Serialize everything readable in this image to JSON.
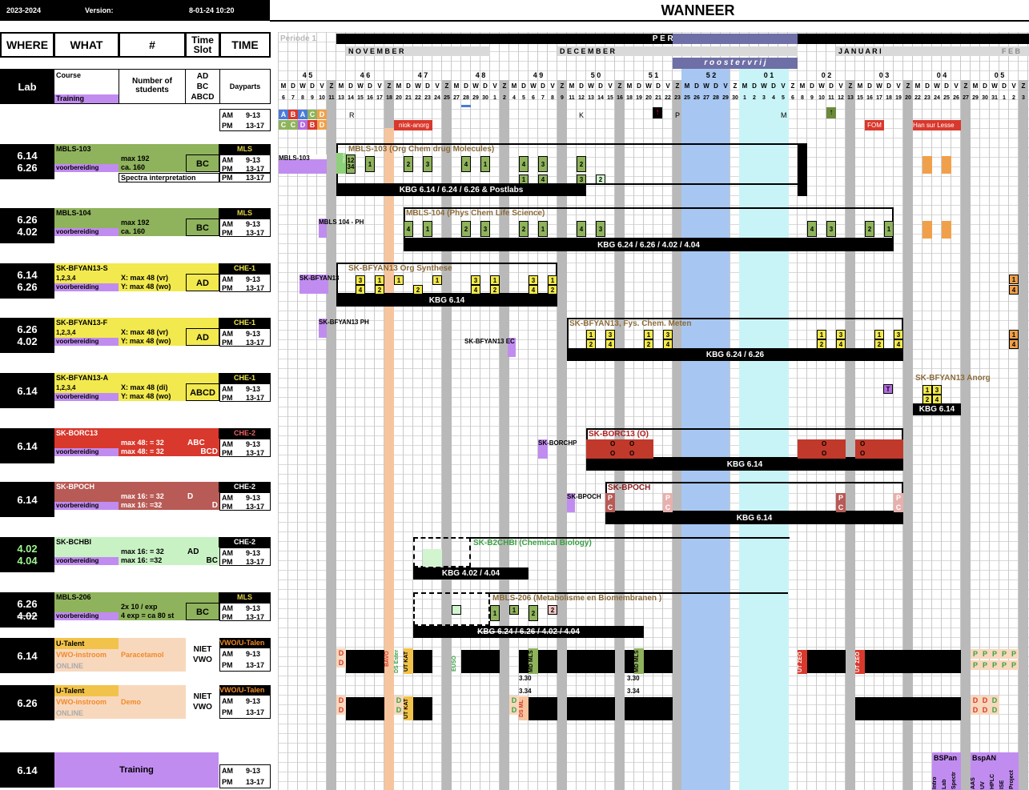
{
  "header": {
    "year": "2023-2024",
    "version_label": "Version:",
    "version_date": "8-01-24 10:20",
    "title": "WANNEER"
  },
  "columns": {
    "where": "WHERE",
    "what": "WHAT",
    "num": "#",
    "timeslot": "Time Slot",
    "time": "TIME"
  },
  "legend": {
    "lab": "Lab",
    "course": "Course",
    "training": "Training",
    "num_students": "Number of students",
    "slots": "AD\nBC\nABCD",
    "dayparts": "Dayparts"
  },
  "am": "AM",
  "pm": "PM",
  "am_time": "9-13",
  "pm_time": "13-17",
  "abcd_am": [
    "A",
    "B",
    "A",
    "C",
    "D"
  ],
  "abcd_pm": [
    "C",
    "C",
    "D",
    "B",
    "D"
  ],
  "periods": {
    "p1": "Periode 1",
    "p2": "P E R I O D E   2",
    "roostervrij": "r o o s t e r v r i j"
  },
  "months": {
    "nov": "N O V E M B E R",
    "dec": "D E C E M B E R",
    "jan": "J A N U A R I",
    "feb": "F E B"
  },
  "weeks": [
    "4 5",
    "4 6",
    "4 7",
    "4 8",
    "4 9",
    "5 0",
    "5 1",
    "5 2",
    "0 1",
    "0 2",
    "0 3",
    "0 4",
    "0 5"
  ],
  "daynames": "M D W D V Z",
  "dates": [
    "6",
    "7",
    "8",
    "9",
    "10",
    "11",
    "13",
    "14",
    "15",
    "16",
    "17",
    "18",
    "20",
    "21",
    "22",
    "23",
    "24",
    "25",
    "27",
    "28",
    "29",
    "30",
    "1",
    "2",
    "4",
    "5",
    "6",
    "7",
    "8",
    "9",
    "11",
    "12",
    "13",
    "14",
    "15",
    "16",
    "18",
    "19",
    "20",
    "21",
    "22",
    "23",
    "25",
    "26",
    "27",
    "28",
    "29",
    "30",
    "1",
    "2",
    "3",
    "4",
    "5",
    "6",
    "8",
    "9",
    "10",
    "11",
    "12",
    "13",
    "15",
    "16",
    "17",
    "18",
    "19",
    "20",
    "22",
    "23",
    "24",
    "25",
    "26",
    "27",
    "29",
    "30",
    "31",
    "1",
    "2",
    "3"
  ],
  "markers": {
    "R": "R",
    "K": "K",
    "P": "P",
    "M": "M",
    "niokanorg": "niok-anorg",
    "fom": "FOM",
    "han": "Han sur Lesse"
  },
  "rows": [
    {
      "lab1": "6.14",
      "lab2": "6.26",
      "course": "MBLS-103",
      "dept": "MLS",
      "train": "voorbereiding",
      "n1": "max 192",
      "n2": "ca. 160",
      "slot": "BC",
      "extra": "Spectra interpretation",
      "tag": "MBLS-103",
      "gtitle": "MBLS-103 (Org Chem drug Molecules)",
      "bar": "KBG 6.14 / 6.24 / 6.26 & Postlabs",
      "color": "#8fb35c"
    },
    {
      "lab1": "6.26",
      "lab2": "4.02",
      "course": "MBLS-104",
      "dept": "MLS",
      "train": "voorbereiding",
      "n1": "max 192",
      "n2": "ca. 160",
      "slot": "BC",
      "tag": "MBLS 104 - PH",
      "gtitle": "MBLS-104 (Phys Chem Life Science)",
      "bar": "KBG 6.24 / 6.26 /  4.02 / 4.04",
      "color": "#8fb35c"
    },
    {
      "lab1": "6.14",
      "lab2": "6.26",
      "course": "SK-BFYAN13-S",
      "dept": "CHE-1",
      "train": "voorbereiding",
      "g": "1,2,3,4",
      "n1": "X: max 48 (vr)",
      "n2": "Y: max 48 (wo)",
      "slot": "AD",
      "tag": "SK-BFYAN13",
      "gtitle": "SK-BFYAN13 Org Synthese",
      "bar": "KBG 6.14",
      "color": "#f2e94e"
    },
    {
      "lab1": "6.26",
      "lab2": "4.02",
      "course": "SK-BFYAN13-F",
      "dept": "CHE-1",
      "train": "voorbereiding",
      "g": "1,2,3,4",
      "n1": "X: max 48 (vr)",
      "n2": "Y: max 48 (wo)",
      "slot": "AD",
      "tag": "SK-BFYAN13 PH",
      "tag2": "SK-BFYAN13 EC",
      "gtitle": "SK-BFYAN13, Fys. Chem. Meten",
      "bar": "KBG 6.24 / 6.26",
      "color": "#f2e94e"
    },
    {
      "lab1": "6.14",
      "lab2": "",
      "course": "SK-BFYAN13-A",
      "dept": "CHE-1",
      "train": "voorbereiding",
      "g": "1,2,3,4",
      "n1": "X: max 48 (di)",
      "n2": "Y: max 48 (wo)",
      "slot": "ABCD",
      "gtitle": "SK-BFYAN13 Anorg",
      "bar": "KBG 6.14",
      "color": "#f2e94e",
      "t": "T"
    },
    {
      "lab1": "6.14",
      "lab2": "",
      "course": "SK-BORC13",
      "dept": "CHE-2",
      "train": "voorbereiding",
      "n1": "max 48: = 32",
      "n2": "max 48: = 32",
      "slot": "ABC",
      "slot2": "BCD",
      "tag": "SK-BORCHP",
      "gtitle": "SK-BORC13 (O)",
      "bar": "KBG 6.14",
      "color": "#d9382c",
      "o": "O"
    },
    {
      "lab1": "6.14",
      "lab2": "",
      "course": "SK-BPOCH",
      "dept": "CHE-2",
      "train": "voorbereiding",
      "n1": "max 16: = 32",
      "n2": "max 16: =32",
      "slot": "D",
      "slot2": "D",
      "tag": "SK-BPOCH",
      "gtitle": "SK-BPOCH",
      "bar": "KBG 6.14",
      "color": "#b85a55",
      "p": "P",
      "c": "C"
    },
    {
      "lab1": "4.02",
      "lab2": "4.04",
      "course": "SK-BCHBI",
      "dept": "CHE-2",
      "train": "voorbereiding",
      "n1": "max 16: = 32",
      "n2": "max 16: =32",
      "slot": "AD",
      "slot2": "BC",
      "gtitle": "SK-B2CHBI (Chemical Biology)",
      "bar": "KBG 4.02 / 4.04",
      "color": "#c9f2c4"
    },
    {
      "lab1": "6.26",
      "lab2": "4.02",
      "course": "MBLS-206",
      "dept": "MLS",
      "train": "voorbereiding",
      "n1": "2x 10 / exp",
      "n2": "4 exp = ca 80 st",
      "slot": "BC",
      "gtitle": "MBLS-206 (Metabolisme en Biomembranen )",
      "bar": "KBG 6.24 / 6.26 / 4.02 / 4.04",
      "color": "#8fb35c"
    }
  ],
  "utalent": [
    {
      "lab": "6.14",
      "name": "U-Talent",
      "sub": "VWO-instroom",
      "online": "ONLINE",
      "topic": "Paracetamol",
      "niet": "NIET VWO",
      "extra": "VWO/U-Talen"
    },
    {
      "lab": "6.26",
      "name": "U-Talent",
      "sub": "VWO-instroom",
      "online": "ONLINE",
      "topic": "Demo",
      "niet": "NIET VWO",
      "extra": "VWO/U-Talen"
    }
  ],
  "training": {
    "lab": "6.14",
    "label": "Training"
  },
  "special": {
    "bavo": "BAVO",
    "dsester": "DS Ester",
    "utkat": "UT KAT",
    "euso": "EUSO",
    "mdmls": "MD MLS",
    "d": "D",
    "n330": "3.30",
    "n334": "3.34",
    "dsml": "DS ML",
    "utzeo": "UT ZEO",
    "bspan": "BSPan",
    "bspan2": "BspAN",
    "bspan_items": [
      "Intro",
      "Lab",
      "Spectr"
    ],
    "bspan2_items": [
      "AAS",
      "UV",
      "HPLC",
      "ISE",
      "Project"
    ],
    "intro": "INTRO",
    "c1234": "12\n34"
  }
}
